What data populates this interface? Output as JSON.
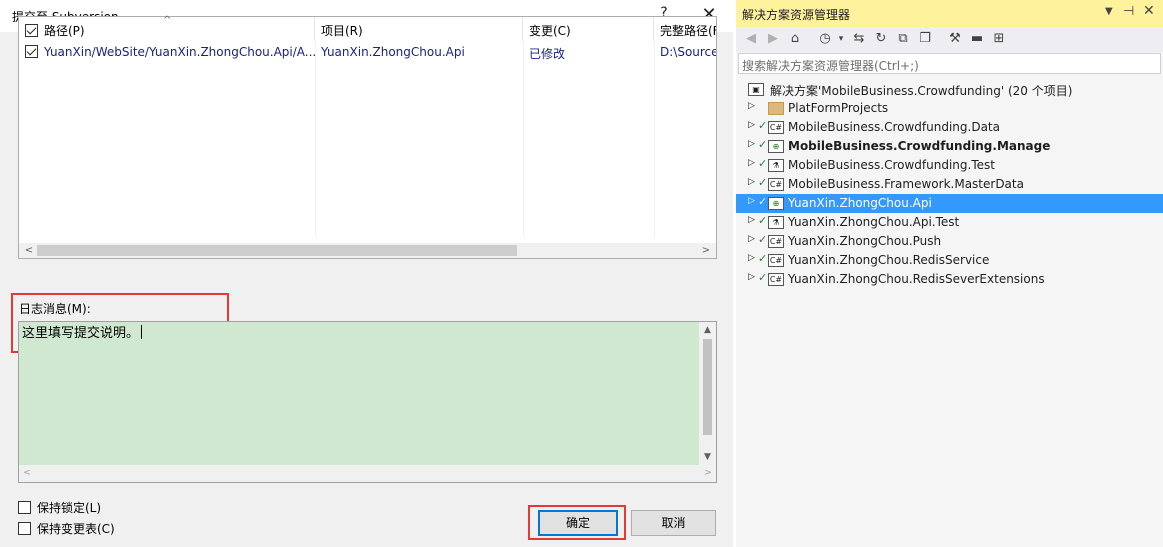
{
  "dialog": {
    "title": "提交至 Subversion",
    "help_label": "?",
    "close_label": "✕",
    "columns": [
      "路径(P)",
      "项目(R)",
      "变更(C)",
      "完整路径(F"
    ],
    "rows": [
      {
        "path": "YuanXin/WebSite/YuanXin.ZhongChou.Api/A...",
        "project": "YuanXin.ZhongChou.Api",
        "change": "已修改",
        "fullpath": "D:\\Source"
      }
    ],
    "log_label": "日志消息(M):",
    "log_text": "这里填写提交说明。",
    "options": [
      {
        "label": "保持锁定(L)",
        "checked": false
      },
      {
        "label": "保持变更表(C)",
        "checked": false
      }
    ],
    "ok_label": "确定",
    "cancel_label": "取消"
  },
  "panel": {
    "title": "解决方案资源管理器",
    "search_placeholder": "搜索解决方案资源管理器(Ctrl+;)",
    "toolbar_icons": [
      "back-icon",
      "forward-icon",
      "home-icon",
      "history-icon",
      "sync-icon",
      "refresh-icon",
      "collapse-icon",
      "copy-icon",
      "properties-icon",
      "preview-icon",
      "diagram-icon"
    ],
    "tree": [
      {
        "label": "解决方案'MobileBusiness.Crowdfunding' (20 个项目)",
        "icon": "solution-icon",
        "level": 0
      },
      {
        "label": "PlatFormProjects",
        "icon": "folder-icon",
        "level": 1
      },
      {
        "label": "MobileBusiness.Crowdfunding.Data",
        "icon": "csharp-project-icon",
        "level": 1
      },
      {
        "label": "MobileBusiness.Crowdfunding.Manage",
        "icon": "web-project-icon",
        "level": 1,
        "bold": true
      },
      {
        "label": "MobileBusiness.Crowdfunding.Test",
        "icon": "test-project-icon",
        "level": 1
      },
      {
        "label": "MobileBusiness.Framework.MasterData",
        "icon": "csharp-project-icon",
        "level": 1
      },
      {
        "label": "YuanXin.ZhongChou.Api",
        "icon": "web-project-icon",
        "level": 1,
        "selected": true
      },
      {
        "label": "YuanXin.ZhongChou.Api.Test",
        "icon": "test-project-icon",
        "level": 1
      },
      {
        "label": "YuanXin.ZhongChou.Push",
        "icon": "csharp-project-icon",
        "level": 1
      },
      {
        "label": "YuanXin.ZhongChou.RedisService",
        "icon": "csharp-project-icon",
        "level": 1
      },
      {
        "label": "YuanXin.ZhongChou.RedisSeverExtensions",
        "icon": "csharp-project-icon",
        "level": 1
      }
    ]
  },
  "colors": {
    "highlight_box": "#e53935",
    "log_background": "#cfe8cf",
    "panel_title_bg": "#fff29d",
    "selection": "#3399ff"
  }
}
